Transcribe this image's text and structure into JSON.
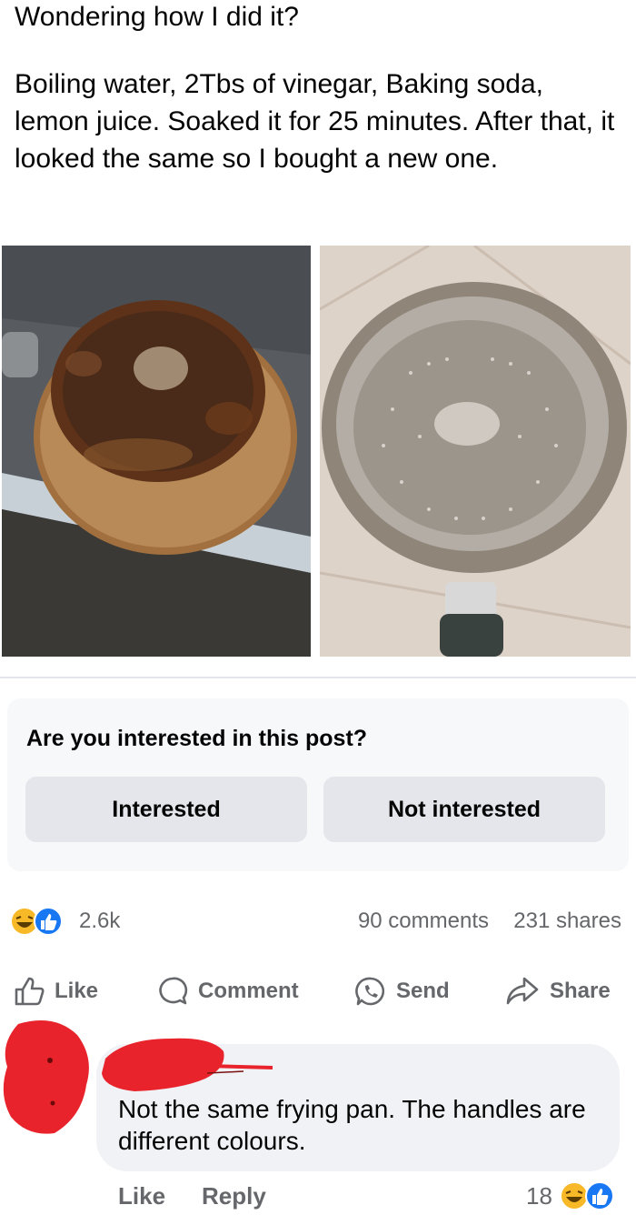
{
  "post": {
    "line1": "Wondering how I did it?",
    "body": "Boiling water, 2Tbs of vinegar, Baking soda, lemon juice. Soaked it for 25 minutes. After that, it looked the same so I bought a new one."
  },
  "interest": {
    "question": "Are you interested in this post?",
    "yes_label": "Interested",
    "no_label": "Not interested"
  },
  "stats": {
    "reactions": "2.6k",
    "comments": "90 comments",
    "shares": "231 shares"
  },
  "actions": {
    "like": "Like",
    "comment": "Comment",
    "send": "Send",
    "share": "Share"
  },
  "comment": {
    "text": "Not the same frying pan. The handles are different colours.",
    "like": "Like",
    "reply": "Reply",
    "reaction_count": "18"
  },
  "colors": {
    "accent": "#1877f2",
    "haha": "#f7b928",
    "redaction": "#e8232b"
  }
}
